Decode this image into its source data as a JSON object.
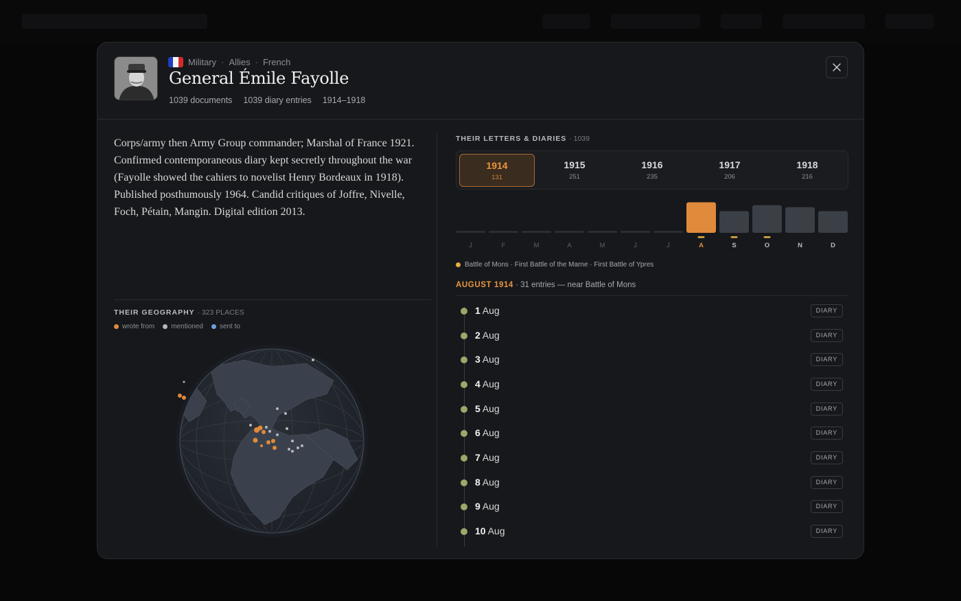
{
  "person": {
    "category": "Military",
    "alliance": "Allies",
    "nationality": "French",
    "flag_colors": [
      "#1f3fbf",
      "#f5f5f5",
      "#d42b2b"
    ],
    "name": "General Émile Fayolle",
    "documents": "1039 documents",
    "diary_entries": "1039 diary entries",
    "years_active": "1914–1918"
  },
  "bio": "Corps/army then Army Group commander; Marshal of France 1921. Confirmed contemporaneous diary kept secretly throughout the war (Fayolle showed the cahiers to novelist Henry Bordeaux in 1918). Published posthumously 1964. Candid critiques of Joffre, Nivelle, Foch, Pétain, Mangin. Digital edition 2013.",
  "geography": {
    "title": "THEIR GEOGRAPHY",
    "count": "· 323 PLACES",
    "legend": [
      {
        "label": "wrote from",
        "color": "#e08a3c"
      },
      {
        "label": "mentioned",
        "color": "#b5b7bb"
      },
      {
        "label": "sent to",
        "color": "#6f9ee0"
      }
    ]
  },
  "letters": {
    "title": "THEIR LETTERS & DIARIES",
    "count": "· 1039",
    "years": [
      {
        "year": "1914",
        "count": "131",
        "active": true
      },
      {
        "year": "1915",
        "count": "251",
        "active": false
      },
      {
        "year": "1916",
        "count": "235",
        "active": false
      },
      {
        "year": "1917",
        "count": "206",
        "active": false
      },
      {
        "year": "1918",
        "count": "216",
        "active": false
      }
    ]
  },
  "accent_color": "#e08a3c",
  "chart_data": {
    "type": "bar",
    "categories": [
      "J",
      "F",
      "M",
      "A",
      "M",
      "J",
      "J",
      "A",
      "S",
      "O",
      "N",
      "D"
    ],
    "values": [
      0,
      0,
      0,
      0,
      0,
      0,
      0,
      31,
      22,
      28,
      26,
      22
    ],
    "selected_index": 7,
    "event_marks": [
      7,
      8,
      9
    ],
    "ylim": [
      0,
      32
    ]
  },
  "events": "Battle of Mons · First Battle of the Marne · First Battle of Ypres",
  "month_heading": {
    "label": "AUGUST 1914",
    "detail": " · 31 entries — near Battle of Mons"
  },
  "entries": [
    {
      "day": "1",
      "month": "Aug",
      "tag": "DIARY"
    },
    {
      "day": "2",
      "month": "Aug",
      "tag": "DIARY"
    },
    {
      "day": "3",
      "month": "Aug",
      "tag": "DIARY"
    },
    {
      "day": "4",
      "month": "Aug",
      "tag": "DIARY"
    },
    {
      "day": "5",
      "month": "Aug",
      "tag": "DIARY"
    },
    {
      "day": "6",
      "month": "Aug",
      "tag": "DIARY"
    },
    {
      "day": "7",
      "month": "Aug",
      "tag": "DIARY"
    },
    {
      "day": "8",
      "month": "Aug",
      "tag": "DIARY"
    },
    {
      "day": "9",
      "month": "Aug",
      "tag": "DIARY"
    },
    {
      "day": "10",
      "month": "Aug",
      "tag": "DIARY"
    }
  ]
}
